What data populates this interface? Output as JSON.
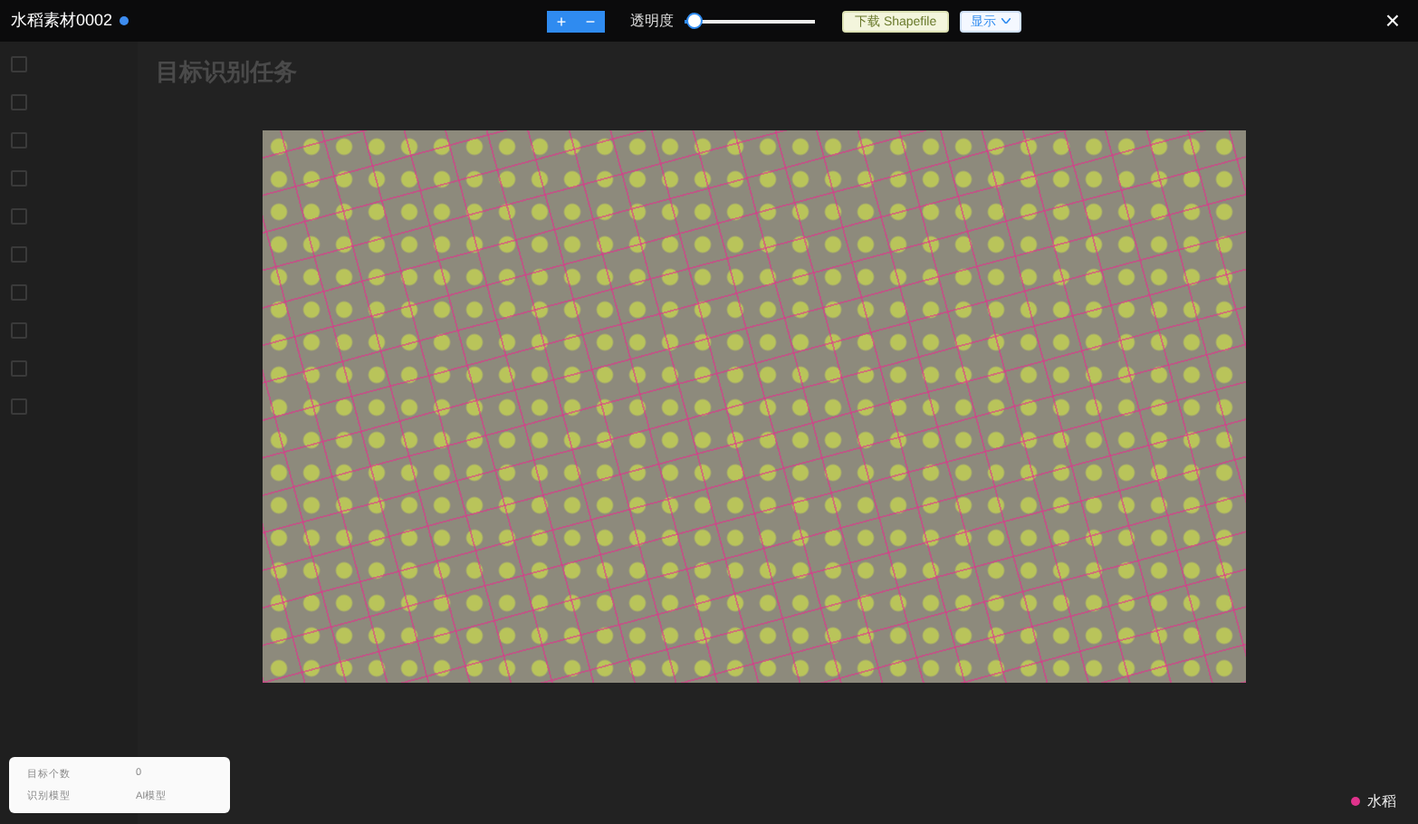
{
  "window": {
    "title": "水稻素材0002",
    "close": "×"
  },
  "toolbar": {
    "zoom_in": "+",
    "zoom_out": "−",
    "opacity": {
      "label": "透明度",
      "level": 0.07
    },
    "download_button": "下载 Shapefile",
    "display_dropdown": "显示"
  },
  "background_page": {
    "title": "目标识别任务"
  },
  "info_card": {
    "rows": [
      {
        "label": "目标个数",
        "value": "0"
      },
      {
        "label": "识别模型",
        "value": "AI模型"
      }
    ]
  },
  "legend": [
    {
      "label": "水稻",
      "color": "#e0338c"
    }
  ]
}
